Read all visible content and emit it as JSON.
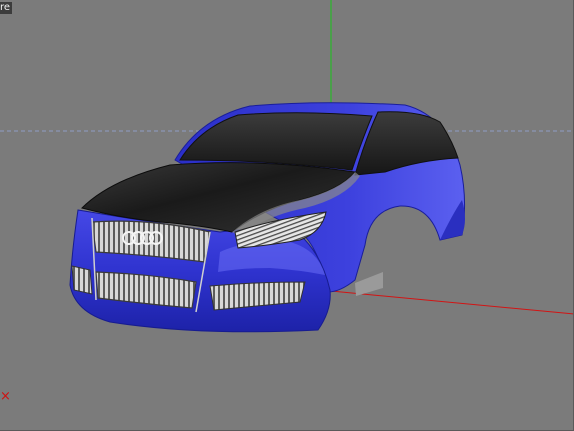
{
  "viewport": {
    "label": "re",
    "axis_marker": "×",
    "colors": {
      "background": "#7b7b7b",
      "axis_y": "#19c519",
      "axis_x": "#d21414",
      "horizon": "#8f9ec4",
      "body_paint": "#3437d6",
      "hood": "#1e1e1e",
      "grille": "#c8c8c8"
    }
  },
  "scene": {
    "object": "car-model",
    "brand_mark": "four-rings"
  }
}
